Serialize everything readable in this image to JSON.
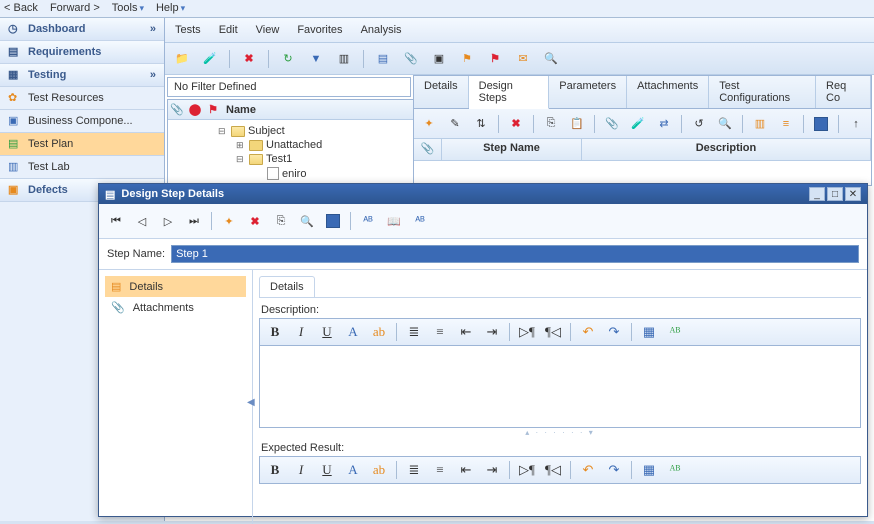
{
  "top_menu": {
    "back": "< Back",
    "forward": "Forward >",
    "tools": "Tools",
    "help": "Help"
  },
  "sidebar": {
    "dashboard": "Dashboard",
    "requirements": "Requirements",
    "testing": "Testing",
    "items": [
      {
        "label": "Test Resources"
      },
      {
        "label": "Business Compone..."
      },
      {
        "label": "Test Plan"
      },
      {
        "label": "Test Lab"
      }
    ],
    "defects": "Defects"
  },
  "menu_bar": {
    "tests": "Tests",
    "edit": "Edit",
    "view": "View",
    "favorites": "Favorites",
    "analysis": "Analysis"
  },
  "filter": {
    "text": "No Filter Defined"
  },
  "tree": {
    "header": "Name",
    "subject": "Subject",
    "unattached": "Unattached",
    "test1": "Test1",
    "eniro": "eniro"
  },
  "tabs": {
    "details": "Details",
    "design_steps": "Design Steps",
    "parameters": "Parameters",
    "attachments": "Attachments",
    "test_configs": "Test Configurations",
    "req_co": "Req Co"
  },
  "grid": {
    "step_name": "Step Name",
    "description": "Description"
  },
  "dialog": {
    "title": "Design Step Details",
    "step_name_label": "Step Name:",
    "step_name_value": "Step 1",
    "nav": {
      "details": "Details",
      "attachments": "Attachments"
    },
    "details_tab": "Details",
    "description_label": "Description:",
    "expected_label": "Expected Result:"
  },
  "rte": {
    "bold": "B",
    "italic": "I",
    "underline": "U",
    "font": "A"
  }
}
